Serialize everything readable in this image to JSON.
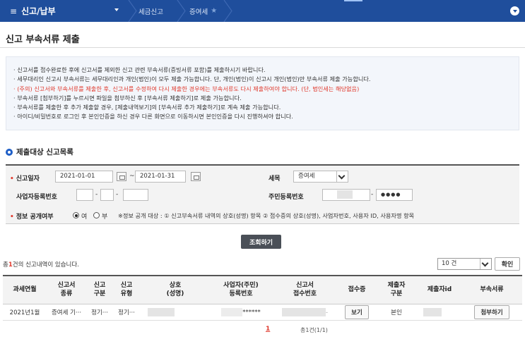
{
  "topnav": {
    "menu_label": "신고/납부",
    "crumb_1": "세금신고",
    "crumb_2": "증여세",
    "colors": {
      "bar": "#1f4e9c",
      "accent": "#9fc3f5"
    }
  },
  "page": {
    "title": "신고 부속서류 제출"
  },
  "notice": {
    "lines": [
      "신고서를 접수완료한 후에 신고서를 제외한 신고 관련 부속서류(증빙서류 포함)를 제출하시기 바랍니다.",
      "세무대리인 신고시 부속서류는 세무대리인과 개인(법인)이 모두 제출 가능합니다. 단, 개인(법인)이 신고시 개인(법인)만 부속서류 제출 가능합니다.",
      "(주의) 신고서와 부속서류를 제출한 후, 신고서를 수정하여 다시 제출한 경우에는 부속서류도 다시 제출하여야 합니다. (단, 법인세는 해당없음)",
      "부속서류 [첨부하기]를 누르시면 파일을 첨부하신 후 [부속서류 제출하기]로 제출 가능합니다.",
      "부속서류를 제출한 후 추가 제출할 경우, [제출내역보기]의 [부속서류 추가 제출하기]로 계속 제출 가능합니다.",
      "아이디/비밀번호로 로그인 후 본인인증을 하신 경우 다른 화면으로 이동하시면 본인인증을 다시 진행하셔야 합니다."
    ]
  },
  "section": {
    "title": "제출대상 신고목록"
  },
  "form": {
    "date_label": "신고일자",
    "date_from": "2021-01-01",
    "date_sep": "~",
    "date_to": "2021-01-31",
    "tax_label": "세목",
    "tax_value": "증여세",
    "bizno_label": "사업자등록번호",
    "resno_label": "주민등록번호",
    "resno_masked": "●●●●",
    "dash": "-",
    "public_label": "정보 공개여부",
    "opt_yes": "여",
    "opt_no": "부",
    "public_note": "※정보 공개 대상 : ① 신고부속서류 내역의 상호(성명) 항목 ② 접수증의 상호(성명), 사업자번호, 사용자 ID, 사용자명 항목"
  },
  "search_button": "조회하기",
  "result": {
    "count_prefix": "총",
    "count_num": "1",
    "count_suffix": "건의 신고내역이 있습니다.",
    "page_size": "10 건",
    "ok_button": "확인"
  },
  "table": {
    "headers": [
      "과세연월",
      "신고서\n종류",
      "신고\n구분",
      "신고\n유형",
      "상호\n(성명)",
      "사업자(주민)\n등록번호",
      "신고서\n접수번호",
      "접수증",
      "제출자\n구분",
      "제출자id",
      "부속서류"
    ],
    "row": {
      "period": "2021년1월",
      "kind": "증여세 기···",
      "type": "정기···",
      "form": "정기···",
      "regno": "******",
      "receipt_suffix": "-",
      "view_button": "보기",
      "submitter": "본인",
      "attach_button": "첨부하기"
    }
  },
  "pager": {
    "current": "1",
    "total": "총1건(1/1)"
  }
}
